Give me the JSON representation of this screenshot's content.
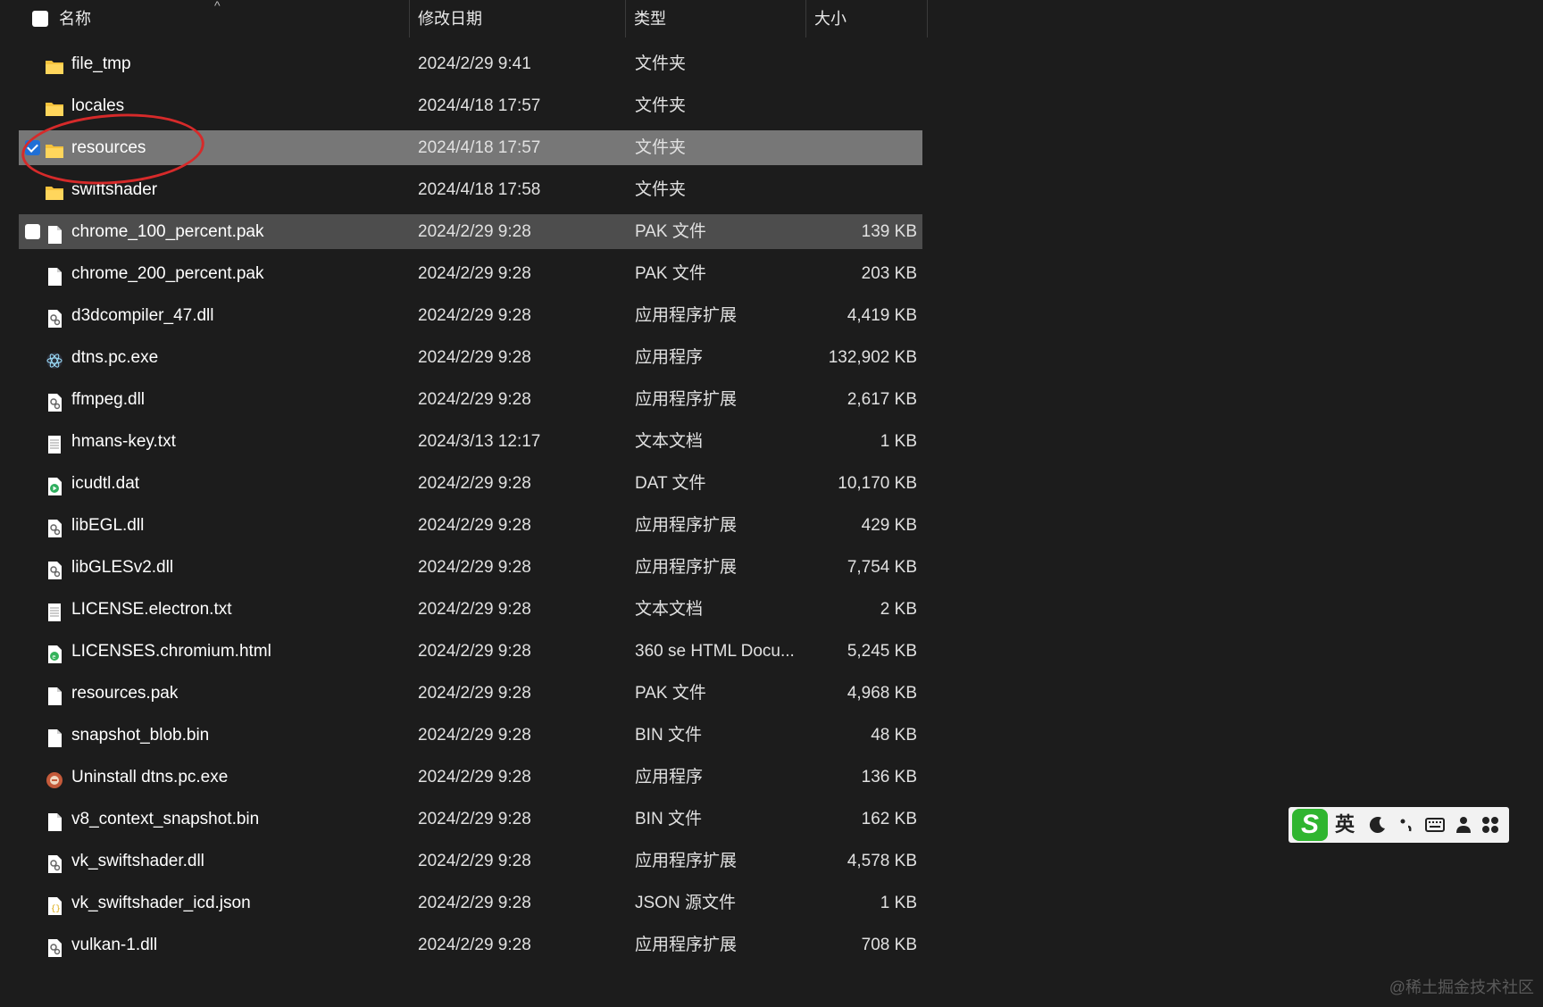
{
  "header": {
    "col_name": "名称",
    "col_date": "修改日期",
    "col_type": "类型",
    "col_size": "大小",
    "sort_indicator": "^"
  },
  "files": [
    {
      "name": "file_tmp",
      "date": "2024/2/29 9:41",
      "type": "文件夹",
      "size": "",
      "icon": "folder-icon"
    },
    {
      "name": "locales",
      "date": "2024/4/18 17:57",
      "type": "文件夹",
      "size": "",
      "icon": "folder-icon"
    },
    {
      "name": "resources",
      "date": "2024/4/18 17:57",
      "type": "文件夹",
      "size": "",
      "icon": "folder-icon",
      "state": "selected"
    },
    {
      "name": "swiftshader",
      "date": "2024/4/18 17:58",
      "type": "文件夹",
      "size": "",
      "icon": "folder-icon"
    },
    {
      "name": "chrome_100_percent.pak",
      "date": "2024/2/29 9:28",
      "type": "PAK 文件",
      "size": "139 KB",
      "icon": "file-icon",
      "state": "hovered"
    },
    {
      "name": "chrome_200_percent.pak",
      "date": "2024/2/29 9:28",
      "type": "PAK 文件",
      "size": "203 KB",
      "icon": "file-icon"
    },
    {
      "name": "d3dcompiler_47.dll",
      "date": "2024/2/29 9:28",
      "type": "应用程序扩展",
      "size": "4,419 KB",
      "icon": "dll-icon"
    },
    {
      "name": "dtns.pc.exe",
      "date": "2024/2/29 9:28",
      "type": "应用程序",
      "size": "132,902 KB",
      "icon": "electron-app-icon"
    },
    {
      "name": "ffmpeg.dll",
      "date": "2024/2/29 9:28",
      "type": "应用程序扩展",
      "size": "2,617 KB",
      "icon": "dll-icon"
    },
    {
      "name": "hmans-key.txt",
      "date": "2024/3/13 12:17",
      "type": "文本文档",
      "size": "1 KB",
      "icon": "text-file-icon"
    },
    {
      "name": "icudtl.dat",
      "date": "2024/2/29 9:28",
      "type": "DAT 文件",
      "size": "10,170 KB",
      "icon": "media-file-icon"
    },
    {
      "name": "libEGL.dll",
      "date": "2024/2/29 9:28",
      "type": "应用程序扩展",
      "size": "429 KB",
      "icon": "dll-icon"
    },
    {
      "name": "libGLESv2.dll",
      "date": "2024/2/29 9:28",
      "type": "应用程序扩展",
      "size": "7,754 KB",
      "icon": "dll-icon"
    },
    {
      "name": "LICENSE.electron.txt",
      "date": "2024/2/29 9:28",
      "type": "文本文档",
      "size": "2 KB",
      "icon": "text-file-icon"
    },
    {
      "name": "LICENSES.chromium.html",
      "date": "2024/2/29 9:28",
      "type": "360 se HTML Docu...",
      "size": "5,245 KB",
      "icon": "html-file-icon"
    },
    {
      "name": "resources.pak",
      "date": "2024/2/29 9:28",
      "type": "PAK 文件",
      "size": "4,968 KB",
      "icon": "file-icon"
    },
    {
      "name": "snapshot_blob.bin",
      "date": "2024/2/29 9:28",
      "type": "BIN 文件",
      "size": "48 KB",
      "icon": "file-icon"
    },
    {
      "name": "Uninstall dtns.pc.exe",
      "date": "2024/2/29 9:28",
      "type": "应用程序",
      "size": "136 KB",
      "icon": "uninstaller-icon"
    },
    {
      "name": "v8_context_snapshot.bin",
      "date": "2024/2/29 9:28",
      "type": "BIN 文件",
      "size": "162 KB",
      "icon": "file-icon"
    },
    {
      "name": "vk_swiftshader.dll",
      "date": "2024/2/29 9:28",
      "type": "应用程序扩展",
      "size": "4,578 KB",
      "icon": "dll-icon"
    },
    {
      "name": "vk_swiftshader_icd.json",
      "date": "2024/2/29 9:28",
      "type": "JSON 源文件",
      "size": "1 KB",
      "icon": "json-file-icon"
    },
    {
      "name": "vulkan-1.dll",
      "date": "2024/2/29 9:28",
      "type": "应用程序扩展",
      "size": "708 KB",
      "icon": "dll-icon"
    }
  ],
  "ime_toolbar": {
    "logo": "S",
    "mode": "英",
    "icons": [
      "moon-icon",
      "punctuation-icon",
      "keyboard-icon",
      "user-icon",
      "apps-icon"
    ]
  },
  "watermark": "@稀土掘金技术社区",
  "colors": {
    "background": "#1c1c1c",
    "selected_row": "#777777",
    "hovered_row": "#4d4d4d",
    "folder": "#f5c23c",
    "checkbox_checked": "#1f6fd6",
    "annotation_circle": "#d62a2a",
    "ime_green": "#2fb52f"
  }
}
